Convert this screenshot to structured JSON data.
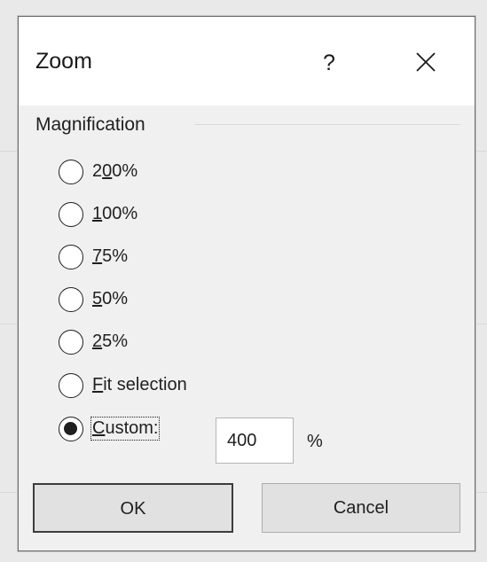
{
  "dialog": {
    "title": "Zoom",
    "help_label": "?",
    "close_icon": "close-icon"
  },
  "magnification": {
    "group_label": "Magnification",
    "options": [
      {
        "label": "200%",
        "accesskey_char": "0",
        "checked": false
      },
      {
        "label": "100%",
        "accesskey_char": "1",
        "checked": false
      },
      {
        "label": "75%",
        "accesskey_char": "7",
        "checked": false
      },
      {
        "label": "50%",
        "accesskey_char": "5",
        "checked": false
      },
      {
        "label": "25%",
        "accesskey_char": "2",
        "checked": false
      },
      {
        "label": "Fit selection",
        "accesskey_char": "F",
        "checked": false
      },
      {
        "label": "Custom:",
        "accesskey_char": "C",
        "checked": true
      }
    ],
    "custom_value": "400",
    "custom_unit": "%"
  },
  "buttons": {
    "ok_label": "OK",
    "cancel_label": "Cancel"
  }
}
